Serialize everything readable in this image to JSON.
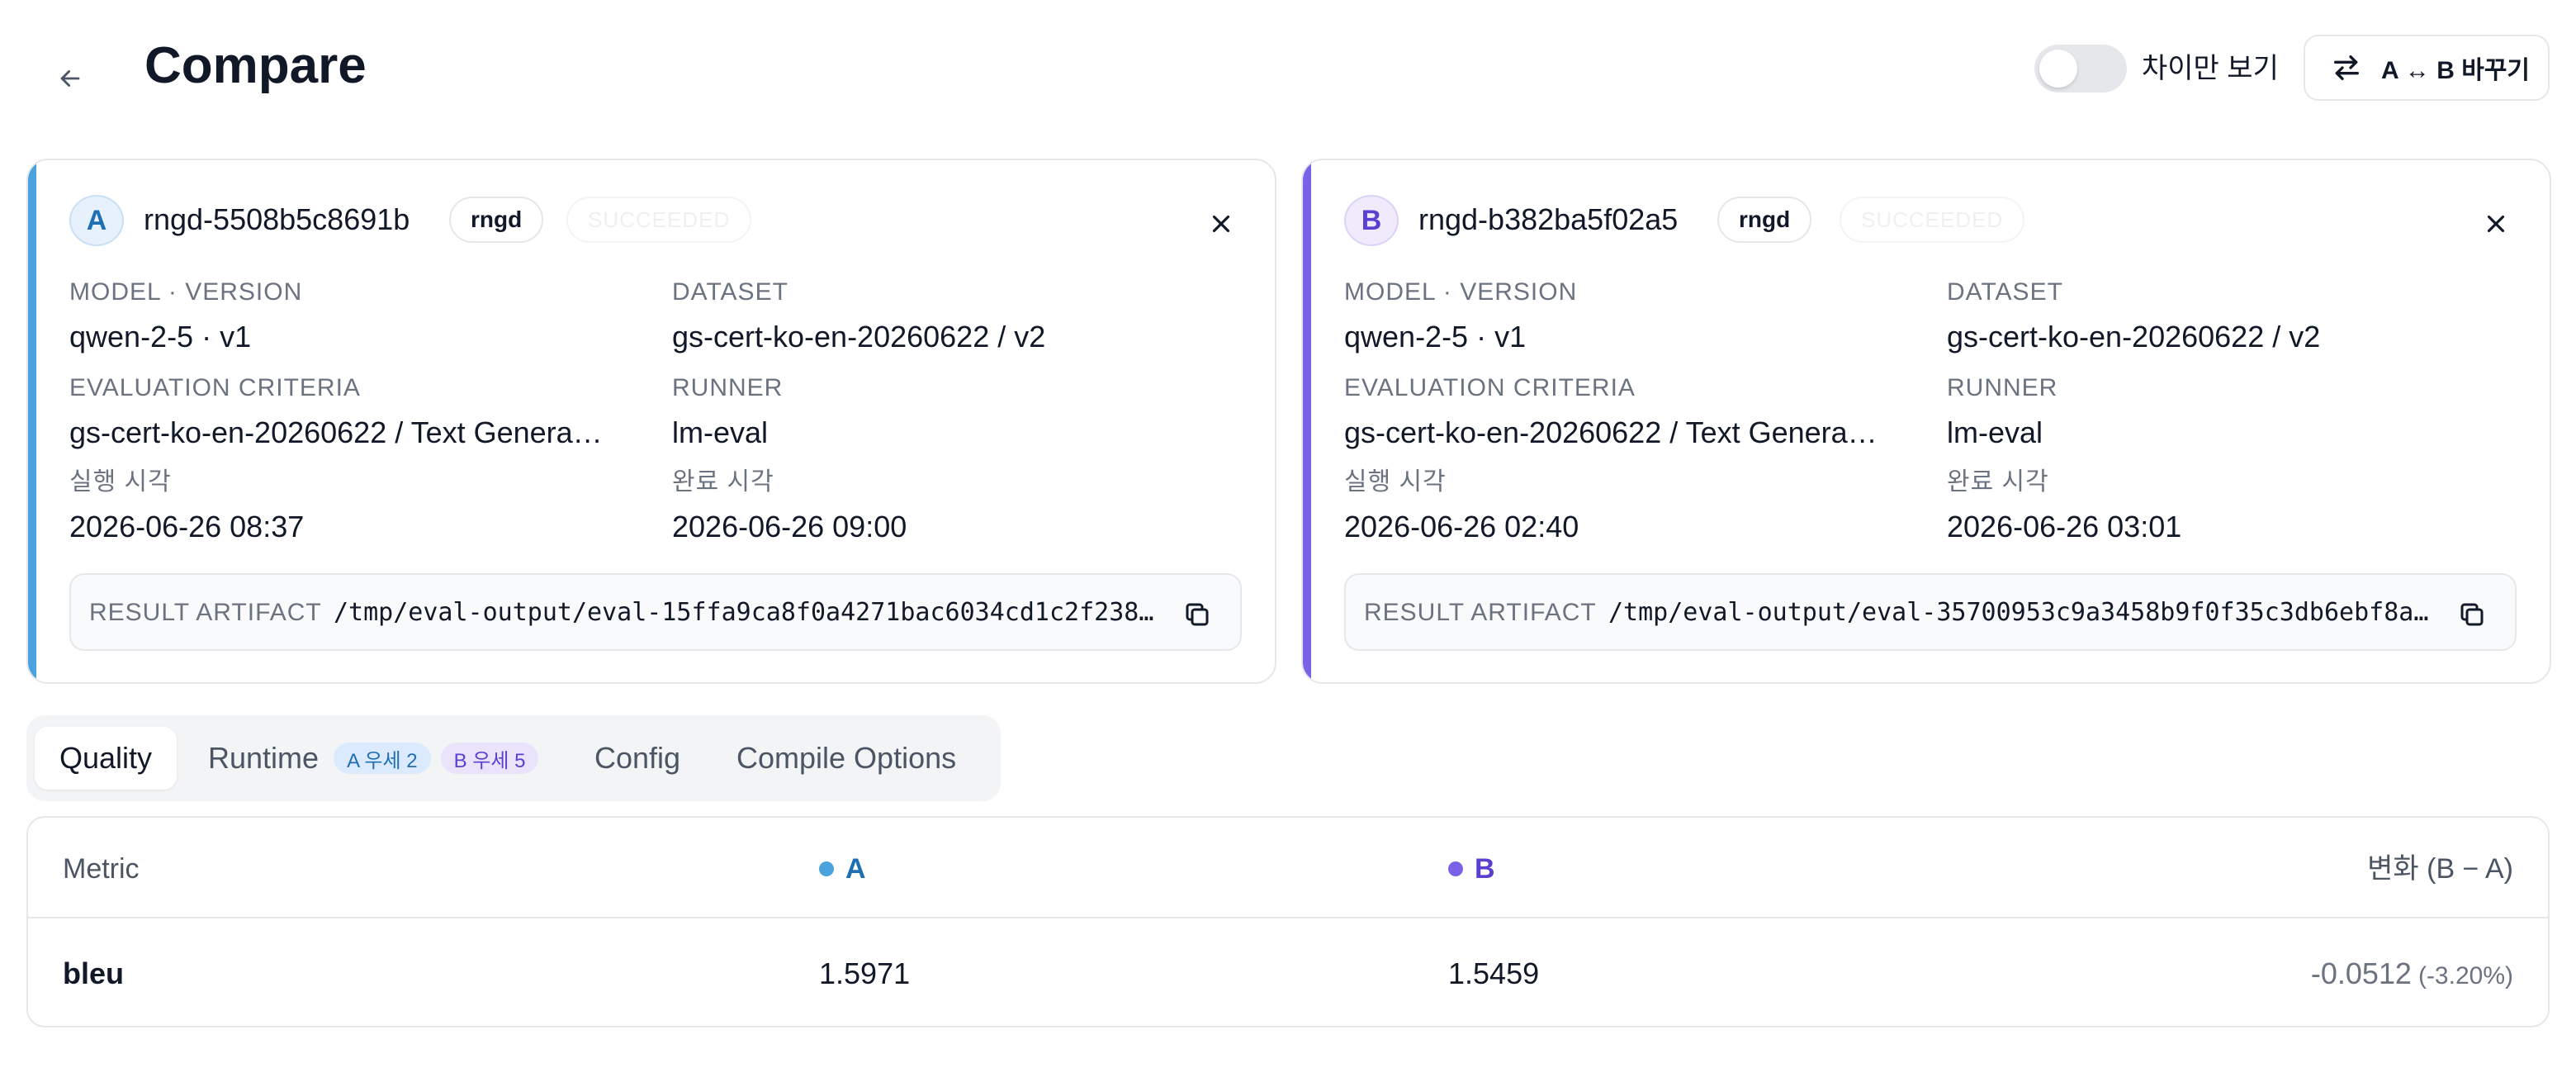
{
  "header": {
    "title": "Compare",
    "diff_only_label": "차이만 보기",
    "diff_only_enabled": false,
    "swap_label": "A ↔ B 바꾸기"
  },
  "runs": {
    "a": {
      "letter": "A",
      "id": "rngd-5508b5c8691b",
      "tag": "rngd",
      "status": "SUCCEEDED",
      "model_version_label": "MODEL · VERSION",
      "model_version": "qwen-2-5 · v1",
      "dataset_label": "DATASET",
      "dataset": "gs-cert-ko-en-20260622 / v2",
      "criteria_label": "EVALUATION CRITERIA",
      "criteria": "gs-cert-ko-en-20260622 / Text Genera…",
      "runner_label": "RUNNER",
      "runner": "lm-eval",
      "started_label": "실행 시각",
      "started": "2026-06-26 08:37",
      "finished_label": "완료 시각",
      "finished": "2026-06-26 09:00",
      "artifact_label": "RESULT ARTIFACT",
      "artifact_path": "/tmp/eval-output/eval-15ffa9ca8f0a4271bac6034cd1c2f238…",
      "accent_color": "#4aa3df"
    },
    "b": {
      "letter": "B",
      "id": "rngd-b382ba5f02a5",
      "tag": "rngd",
      "status": "SUCCEEDED",
      "model_version_label": "MODEL · VERSION",
      "model_version": "qwen-2-5 · v1",
      "dataset_label": "DATASET",
      "dataset": "gs-cert-ko-en-20260622 / v2",
      "criteria_label": "EVALUATION CRITERIA",
      "criteria": "gs-cert-ko-en-20260622 / Text Genera…",
      "runner_label": "RUNNER",
      "runner": "lm-eval",
      "started_label": "실행 시각",
      "started": "2026-06-26 02:40",
      "finished_label": "완료 시각",
      "finished": "2026-06-26 03:01",
      "artifact_label": "RESULT ARTIFACT",
      "artifact_path": "/tmp/eval-output/eval-35700953c9a3458b9f0f35c3db6ebf8a…",
      "accent_color": "#7b61e8"
    }
  },
  "tabs": {
    "quality": "Quality",
    "runtime": "Runtime",
    "runtime_a_badge": "A 우세 2",
    "runtime_b_badge": "B 우세 5",
    "config": "Config",
    "compile": "Compile Options",
    "active": "quality"
  },
  "table": {
    "col_metric": "Metric",
    "col_a": "A",
    "col_b": "B",
    "col_delta": "변화 (B − A)",
    "rows": [
      {
        "metric": "bleu",
        "a": "1.5971",
        "b": "1.5459",
        "delta": "-0.0512",
        "delta_pct": "(-3.20%)"
      }
    ]
  },
  "icons": {
    "back": "arrow-left-icon",
    "swap": "swap-arrows-icon",
    "close": "close-icon",
    "copy": "copy-icon"
  }
}
